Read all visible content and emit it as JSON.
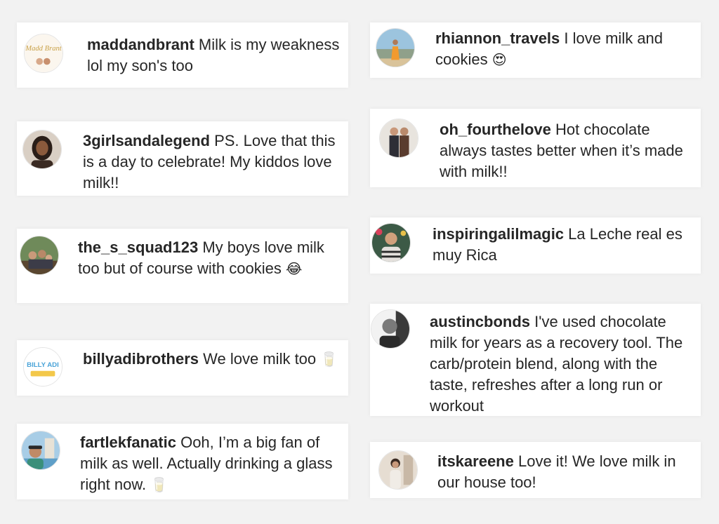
{
  "comments": [
    {
      "username": "maddandbrant",
      "text": "Milk is my weakness lol my son's too",
      "avatar": "logo-avatar",
      "emoji": ""
    },
    {
      "username": "3girlsandalegend",
      "text": "PS. Love that this is a day to celebrate! My kiddos love milk!!",
      "avatar": "portrait-avatar",
      "emoji": ""
    },
    {
      "username": "the_s_squad123",
      "text": "My boys love milk too but of course with cookies",
      "avatar": "family-photo-avatar",
      "emoji": "😂"
    },
    {
      "username": "billyadibrothers",
      "text": "We love milk too",
      "avatar": "logo-avatar",
      "emoji": "🥛"
    },
    {
      "username": "fartlekfanatic",
      "text": "Ooh, I’m a big fan of milk as well. Actually drinking a glass right now.",
      "avatar": "selfie-avatar",
      "emoji": "🥛"
    },
    {
      "username": "rhiannon_travels",
      "text": "I love milk and cookies",
      "avatar": "beach-photo-avatar",
      "emoji": "😍"
    },
    {
      "username": "oh_fourthelove",
      "text": "Hot chocolate always tastes better when it’s made with milk!!",
      "avatar": "group-photo-avatar",
      "emoji": ""
    },
    {
      "username": "inspiringalilmagic",
      "text": "La Leche real es muy Rica",
      "avatar": "portrait-avatar",
      "emoji": ""
    },
    {
      "username": "austincbonds",
      "text": "I've used chocolate milk for years as a recovery tool. The carb/protein blend, along with the taste, refreshes after a long run or workout",
      "avatar": "portrait-avatar",
      "emoji": ""
    },
    {
      "username": "itskareene",
      "text": "Love it! We love milk in our house too!",
      "avatar": "portrait-avatar",
      "emoji": ""
    }
  ],
  "avatar_logos": {
    "maddandbrant": "Madd Brant",
    "billyadibrothers": "BILLY ADI"
  },
  "colors": {
    "background": "#f2f2f2",
    "card": "#ffffff",
    "text": "#262626"
  }
}
